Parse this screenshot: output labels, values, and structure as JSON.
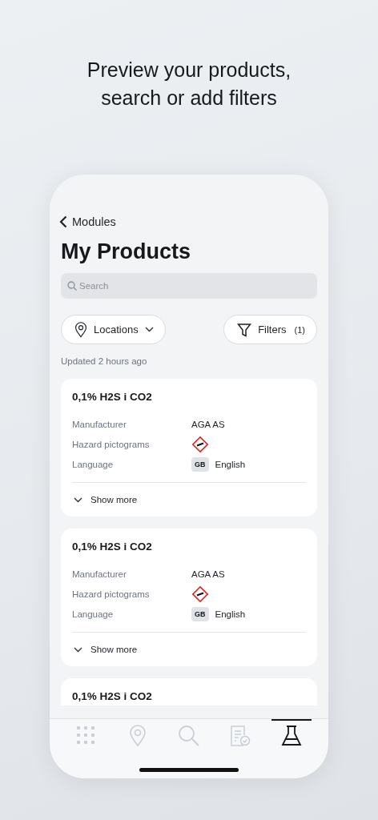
{
  "headline": "Preview your products, search or add filters",
  "back_link": {
    "label": "Modules"
  },
  "title": "My Products",
  "search": {
    "placeholder": "Search"
  },
  "location_button": {
    "label": "Locations"
  },
  "filter_button": {
    "label": "Filters",
    "count": "(1)"
  },
  "updated": "Updated 2 hours ago",
  "products": [
    {
      "name": "0,1% H2S i CO2",
      "fields": [
        {
          "kind": "text",
          "label": "Manufacturer",
          "value": "AGA AS"
        },
        {
          "kind": "hazard",
          "label": "Hazard pictograms"
        },
        {
          "kind": "language",
          "label": "Language",
          "code": "GB",
          "value": "English"
        }
      ],
      "more": "Show more"
    },
    {
      "name": "0,1% H2S i CO2",
      "fields": [
        {
          "kind": "text",
          "label": "Manufacturer",
          "value": "AGA AS"
        },
        {
          "kind": "hazard",
          "label": "Hazard pictograms"
        },
        {
          "kind": "language",
          "label": "Language",
          "code": "GB",
          "value": "English"
        }
      ],
      "more": "Show more"
    },
    {
      "name": "0,1% H2S i CO2"
    }
  ],
  "tab_bar": [
    {
      "kind": "grid",
      "selected": false
    },
    {
      "kind": "location",
      "selected": false
    },
    {
      "kind": "search",
      "selected": false
    },
    {
      "kind": "document",
      "selected": false
    },
    {
      "kind": "flask",
      "selected": true
    }
  ]
}
